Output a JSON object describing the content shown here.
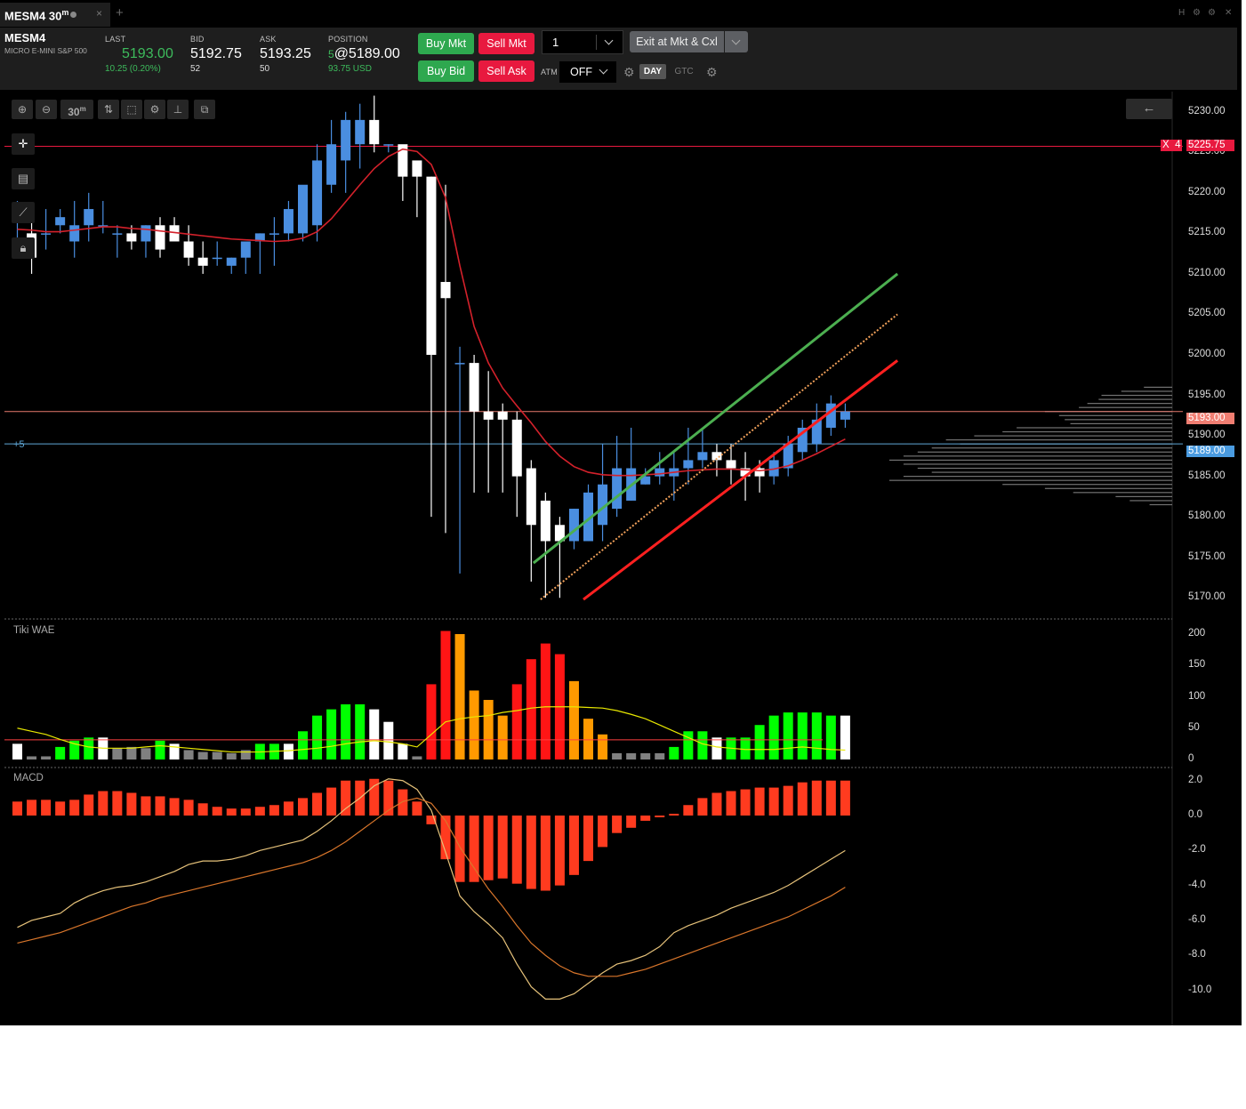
{
  "tab": {
    "title": "MESM4 30",
    "sup": "m",
    "close": "×",
    "new_tab": "+"
  },
  "window": {
    "h": "H",
    "gear": "⚙",
    "min": "⚙",
    "close": "✕"
  },
  "instrument": {
    "symbol": "MESM4",
    "name": "MICRO E-MINI S&P 500"
  },
  "quote": {
    "last_label": "LAST",
    "last": "5193.00",
    "change": "10.25 (0.20%)",
    "bid_label": "BID",
    "bid": "5192.75",
    "bid_size": "52",
    "ask_label": "ASK",
    "ask": "5193.25",
    "ask_size": "50",
    "position_label": "POSITION",
    "position_qty": "5",
    "position_price": "@5189.00",
    "position_pnl": "93.75 USD"
  },
  "orders": {
    "buy_mkt": "Buy Mkt",
    "sell_mkt": "Sell Mkt",
    "buy_bid": "Buy Bid",
    "sell_ask": "Sell Ask",
    "quantity": "1",
    "exit": "Exit at Mkt & Cxl",
    "atm_label": "ATM",
    "atm_value": "OFF",
    "day": "DAY",
    "gtc": "GTC"
  },
  "chart_toolbar": {
    "zoom_in": "⊕",
    "zoom_out": "⊖",
    "interval": "30",
    "interval_sup": "m"
  },
  "chart": {
    "price_labels": [
      "5230.00",
      "5225.00",
      "5220.00",
      "5215.00",
      "5210.00",
      "5205.00",
      "5200.00",
      "5195.00",
      "5190.00",
      "5185.00",
      "5180.00",
      "5175.00",
      "5170.00"
    ],
    "order_tag_x": "X",
    "order_tag_qty": "4",
    "order_price": "5225.75",
    "last_price_tag": "5193.00",
    "position_price_tag": "5189.00",
    "position_offset": "+5",
    "colors": {
      "order_line": "#e8193f",
      "last_line": "#e87a6e",
      "position_line": "#5fa8d8",
      "up_candle": "#4a8ee0",
      "down_candle": "#ffffff",
      "ma": "#d4212b",
      "green_trend": "#4caf50",
      "red_trend": "#ff2020",
      "dotted_trend": "#f0a05a"
    }
  },
  "panels": {
    "wae": {
      "title": "Tiki WAE",
      "labels": [
        "200",
        "150",
        "100",
        "50",
        "0"
      ]
    },
    "macd": {
      "title": "MACD",
      "labels": [
        "2.0",
        "0.0",
        "-2.0",
        "-4.0",
        "-6.0",
        "-8.0",
        "-10.0"
      ]
    }
  },
  "chart_data": {
    "type": "bar",
    "title": "MESM4 30m",
    "price_axis": {
      "min": 5167.5,
      "max": 5232.5
    },
    "candles": [
      [
        5217,
        5219,
        5213,
        5217
      ],
      [
        5215,
        5217,
        5210,
        5212
      ],
      [
        5215,
        5218,
        5213,
        5215
      ],
      [
        5216,
        5218,
        5215,
        5217
      ],
      [
        5214,
        5219,
        5212,
        5216
      ],
      [
        5216,
        5220,
        5214,
        5218
      ],
      [
        5216,
        5219,
        5215,
        5216
      ],
      [
        5215,
        5216,
        5212,
        5215
      ],
      [
        5215,
        5216,
        5213,
        5214
      ],
      [
        5214,
        5216,
        5212,
        5216
      ],
      [
        5216,
        5217,
        5212,
        5213
      ],
      [
        5216,
        5217,
        5215,
        5214
      ],
      [
        5214,
        5216,
        5211,
        5212
      ],
      [
        5212,
        5214,
        5210,
        5211
      ],
      [
        5212,
        5214,
        5211,
        5212
      ],
      [
        5211,
        5212,
        5210,
        5212
      ],
      [
        5212,
        5214,
        5210,
        5214
      ],
      [
        5214,
        5215,
        5210,
        5215
      ],
      [
        5215,
        5217,
        5211,
        5215
      ],
      [
        5215,
        5219,
        5214,
        5218
      ],
      [
        5215,
        5219,
        5214,
        5221
      ],
      [
        5216,
        5226,
        5214,
        5224
      ],
      [
        5221,
        5229,
        5220,
        5226
      ],
      [
        5224,
        5230,
        5220,
        5229
      ],
      [
        5226,
        5231,
        5223,
        5229
      ],
      [
        5229,
        5232,
        5225,
        5226
      ],
      [
        5226,
        5226,
        5225,
        5226
      ],
      [
        5226,
        5225,
        5219,
        5222
      ],
      [
        5224,
        5223,
        5217,
        5222
      ],
      [
        5222,
        5222,
        5180,
        5200
      ],
      [
        5209,
        5221,
        5178,
        5207
      ],
      [
        5199,
        5201,
        5173,
        5199
      ],
      [
        5199,
        5200,
        5183,
        5193
      ],
      [
        5193,
        5198,
        5183,
        5192
      ],
      [
        5193,
        5194,
        5183,
        5192
      ],
      [
        5192,
        5193,
        5180,
        5185
      ],
      [
        5186,
        5187,
        5172,
        5179
      ],
      [
        5182,
        5183,
        5170,
        5177
      ],
      [
        5179,
        5180,
        5170,
        5177
      ],
      [
        5177,
        5181,
        5176,
        5181
      ],
      [
        5177,
        5184,
        5177,
        5183
      ],
      [
        5179,
        5189,
        5177,
        5184
      ],
      [
        5181,
        5190,
        5180,
        5186
      ],
      [
        5182,
        5191,
        5182,
        5186
      ],
      [
        5184,
        5186,
        5184,
        5185
      ],
      [
        5185,
        5188,
        5184,
        5186
      ],
      [
        5185,
        5188,
        5182,
        5186
      ],
      [
        5186,
        5191,
        5184,
        5187
      ],
      [
        5187,
        5191,
        5186,
        5188
      ],
      [
        5188,
        5189,
        5185,
        5187
      ],
      [
        5187,
        5189,
        5184,
        5186
      ],
      [
        5186,
        5188,
        5182,
        5185
      ],
      [
        5186,
        5187,
        5183,
        5185
      ],
      [
        5185,
        5188,
        5184,
        5187
      ],
      [
        5186,
        5190,
        5185,
        5189
      ],
      [
        5188,
        5192,
        5187,
        5191
      ],
      [
        5189,
        5194,
        5188,
        5192
      ],
      [
        5191,
        5195,
        5190,
        5194
      ],
      [
        5192,
        5194,
        5191,
        5193
      ]
    ],
    "ma": [
      5215.5,
      5215.4,
      5215.2,
      5215.2,
      5215.4,
      5215.6,
      5215.8,
      5215.8,
      5215.6,
      5215.5,
      5215.3,
      5215.1,
      5214.9,
      5214.7,
      5214.5,
      5214.3,
      5214.2,
      5214.1,
      5214.0,
      5214.1,
      5214.4,
      5215.2,
      5216.8,
      5218.9,
      5221.0,
      5223.0,
      5224.5,
      5225.4,
      5225.1,
      5223.5,
      5219.4,
      5211.0,
      5203.5,
      5199.0,
      5195.9,
      5193.7,
      5191.6,
      5189.3,
      5187.5,
      5186.2,
      5185.5,
      5185.2,
      5185.1,
      5185.1,
      5185.2,
      5185.3,
      5185.5,
      5185.7,
      5185.8,
      5185.9,
      5185.9,
      5185.8,
      5185.7,
      5185.9,
      5186.3,
      5187.0,
      5187.8,
      5188.7,
      5189.6
    ],
    "order_line": 5225.75,
    "last_price": 5193.0,
    "position_price": 5189.0,
    "trendlines": [
      {
        "name": "green",
        "from": [
          36.5,
          5174.3
        ],
        "to": [
          62,
          5210.0
        ]
      },
      {
        "name": "dotted",
        "from": [
          37,
          5169.8
        ],
        "to": [
          62,
          5205.0
        ]
      },
      {
        "name": "red",
        "from": [
          40,
          5169.8
        ],
        "to": [
          62,
          5199.3
        ]
      }
    ],
    "wae": {
      "range": [
        0,
        200
      ],
      "bars": [
        [
          25,
          "w"
        ],
        [
          5,
          "g"
        ],
        [
          5,
          "g"
        ],
        [
          20,
          "l"
        ],
        [
          30,
          "l"
        ],
        [
          35,
          "l"
        ],
        [
          35,
          "w"
        ],
        [
          18,
          "g"
        ],
        [
          20,
          "g"
        ],
        [
          18,
          "g"
        ],
        [
          30,
          "l"
        ],
        [
          25,
          "w"
        ],
        [
          15,
          "g"
        ],
        [
          12,
          "g"
        ],
        [
          12,
          "g"
        ],
        [
          10,
          "g"
        ],
        [
          15,
          "g"
        ],
        [
          25,
          "l"
        ],
        [
          25,
          "l"
        ],
        [
          25,
          "w"
        ],
        [
          45,
          "l"
        ],
        [
          70,
          "l"
        ],
        [
          80,
          "l"
        ],
        [
          88,
          "l"
        ],
        [
          88,
          "l"
        ],
        [
          80,
          "w"
        ],
        [
          60,
          "w"
        ],
        [
          25,
          "w"
        ],
        [
          5,
          "g"
        ],
        [
          120,
          "r"
        ],
        [
          205,
          "r"
        ],
        [
          200,
          "o"
        ],
        [
          110,
          "o"
        ],
        [
          95,
          "o"
        ],
        [
          70,
          "o"
        ],
        [
          120,
          "r"
        ],
        [
          160,
          "r"
        ],
        [
          185,
          "r"
        ],
        [
          168,
          "r"
        ],
        [
          125,
          "o"
        ],
        [
          65,
          "o"
        ],
        [
          40,
          "o"
        ],
        [
          10,
          "g"
        ],
        [
          10,
          "g"
        ],
        [
          10,
          "g"
        ],
        [
          10,
          "g"
        ],
        [
          20,
          "l"
        ],
        [
          45,
          "l"
        ],
        [
          45,
          "l"
        ],
        [
          35,
          "w"
        ],
        [
          35,
          "l"
        ],
        [
          35,
          "l"
        ],
        [
          55,
          "l"
        ],
        [
          70,
          "l"
        ],
        [
          75,
          "l"
        ],
        [
          75,
          "l"
        ],
        [
          75,
          "l"
        ],
        [
          70,
          "l"
        ],
        [
          70,
          "w"
        ]
      ],
      "signal": [
        50,
        45,
        40,
        32,
        25,
        20,
        18,
        18,
        18,
        20,
        22,
        20,
        18,
        16,
        14,
        12,
        12,
        12,
        13,
        14,
        16,
        18,
        21,
        25,
        28,
        30,
        28,
        25,
        20,
        40,
        60,
        65,
        68,
        70,
        75,
        78,
        82,
        84,
        84,
        84,
        83,
        82,
        78,
        72,
        65,
        55,
        45,
        35,
        25,
        20,
        18,
        16,
        16,
        16,
        18,
        20,
        18,
        16,
        15
      ],
      "deadzone": 20
    },
    "macd": {
      "range": [
        -11.5,
        2.75
      ],
      "histogram": [
        0.8,
        0.9,
        0.9,
        0.8,
        0.9,
        1.2,
        1.4,
        1.4,
        1.3,
        1.1,
        1.1,
        1.0,
        0.9,
        0.7,
        0.5,
        0.4,
        0.4,
        0.5,
        0.6,
        0.8,
        1.0,
        1.3,
        1.6,
        2.0,
        2.0,
        2.1,
        2.0,
        1.5,
        0.8,
        -0.5,
        -2.5,
        -3.8,
        -3.8,
        -3.7,
        -3.6,
        -3.9,
        -4.2,
        -4.3,
        -4.0,
        -3.4,
        -2.6,
        -1.8,
        -1.0,
        -0.7,
        -0.3,
        -0.1,
        0.1,
        0.6,
        1.0,
        1.3,
        1.4,
        1.5,
        1.6,
        1.6,
        1.7,
        1.9,
        2.0,
        2.0,
        2.0
      ],
      "macd_line": [
        -6.4,
        -6.0,
        -5.8,
        -5.6,
        -5.0,
        -4.6,
        -4.3,
        -4.1,
        -4.0,
        -3.8,
        -3.5,
        -3.2,
        -2.8,
        -2.6,
        -2.6,
        -2.5,
        -2.3,
        -2.0,
        -1.8,
        -1.6,
        -1.4,
        -0.9,
        -0.3,
        0.4,
        1.0,
        1.7,
        2.1,
        2.0,
        1.5,
        0.3,
        -2.1,
        -4.6,
        -5.5,
        -6.2,
        -7.0,
        -8.5,
        -9.8,
        -10.5,
        -10.5,
        -10.2,
        -9.6,
        -9.0,
        -8.5,
        -8.3,
        -8.0,
        -7.5,
        -6.7,
        -6.3,
        -6.0,
        -5.7,
        -5.3,
        -5.0,
        -4.7,
        -4.4,
        -4.0,
        -3.5,
        -3.0,
        -2.5,
        -2.0
      ],
      "signal_line": [
        -7.3,
        -7.1,
        -6.9,
        -6.7,
        -6.4,
        -6.1,
        -5.8,
        -5.5,
        -5.2,
        -5.0,
        -4.7,
        -4.5,
        -4.3,
        -4.1,
        -3.9,
        -3.7,
        -3.5,
        -3.3,
        -3.1,
        -2.9,
        -2.7,
        -2.4,
        -2.0,
        -1.5,
        -0.9,
        -0.3,
        0.3,
        0.8,
        1.0,
        0.7,
        -0.3,
        -1.8,
        -3.0,
        -4.2,
        -5.2,
        -6.3,
        -7.3,
        -8.0,
        -8.6,
        -9.0,
        -9.2,
        -9.2,
        -9.2,
        -9.0,
        -8.8,
        -8.5,
        -8.2,
        -7.9,
        -7.6,
        -7.3,
        -7.0,
        -6.7,
        -6.4,
        -6.1,
        -5.8,
        -5.4,
        -5.0,
        -4.6,
        -4.1
      ]
    },
    "volume_profile": [
      [
        5196,
        0.1
      ],
      [
        5195.5,
        0.18
      ],
      [
        5195,
        0.25
      ],
      [
        5194.5,
        0.26
      ],
      [
        5194,
        0.3
      ],
      [
        5193.5,
        0.33
      ],
      [
        5193,
        0.45
      ],
      [
        5192.5,
        0.4
      ],
      [
        5192,
        0.38
      ],
      [
        5191.5,
        0.36
      ],
      [
        5191,
        0.55
      ],
      [
        5190.5,
        0.6
      ],
      [
        5190,
        0.7
      ],
      [
        5189.5,
        0.8
      ],
      [
        5189,
        0.75
      ],
      [
        5188.5,
        0.85
      ],
      [
        5188,
        0.9
      ],
      [
        5187.5,
        0.95
      ],
      [
        5187,
        1.0
      ],
      [
        5186.5,
        0.95
      ],
      [
        5186,
        0.9
      ],
      [
        5185.5,
        0.85
      ],
      [
        5185,
        0.95
      ],
      [
        5184.5,
        1.0
      ],
      [
        5184,
        0.6
      ],
      [
        5183.5,
        0.45
      ],
      [
        5183,
        0.35
      ],
      [
        5182.5,
        0.2
      ],
      [
        5182,
        0.15
      ],
      [
        5181.5,
        0.08
      ]
    ]
  }
}
